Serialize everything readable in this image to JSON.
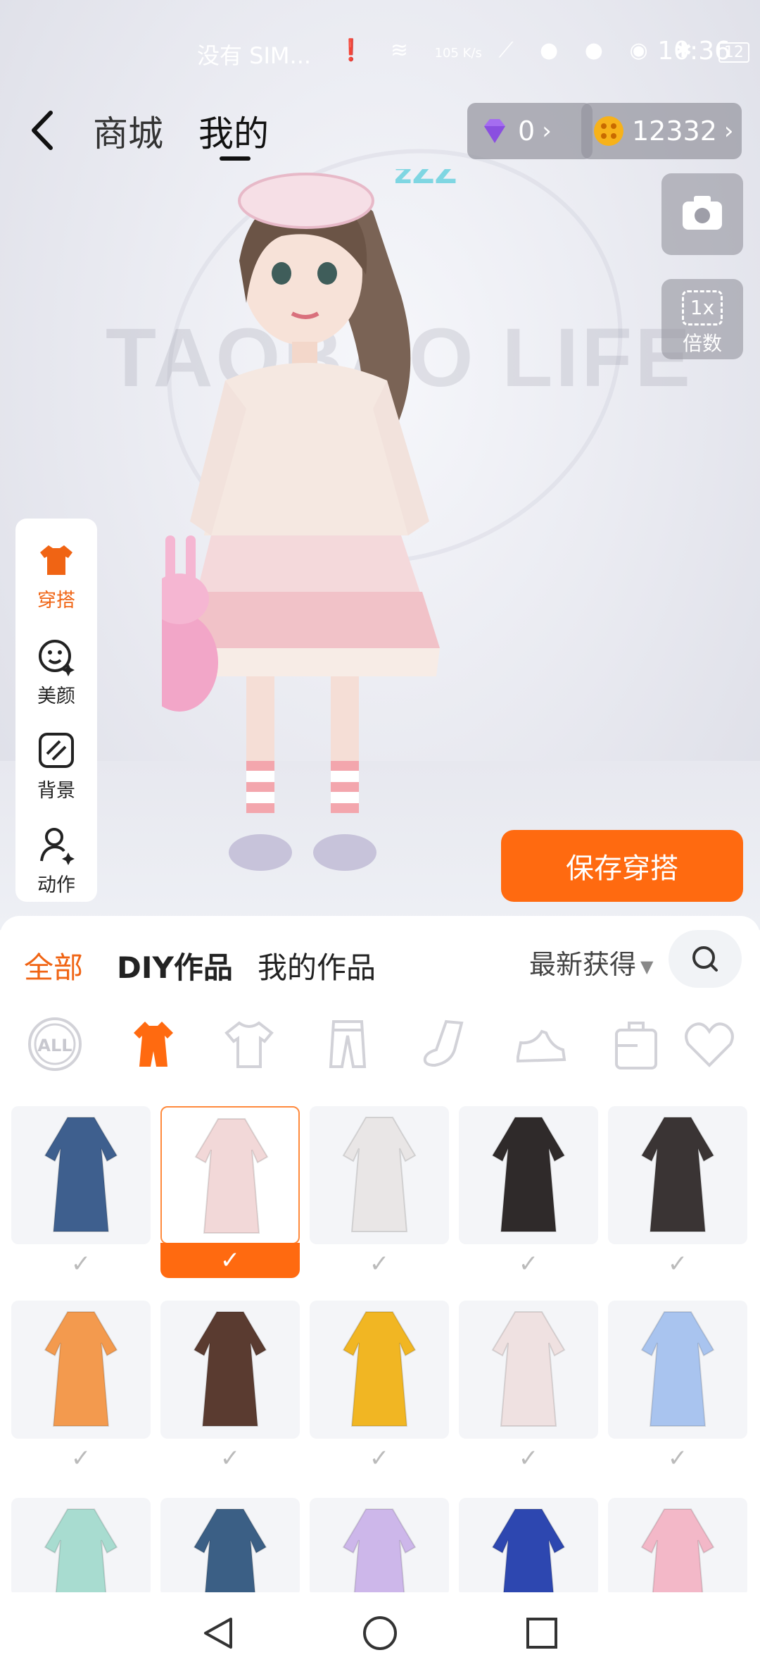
{
  "status_bar": {
    "carrier": "没有 SIM...",
    "net_speed": "105 K/s",
    "battery": "12",
    "time": "10:36"
  },
  "top_nav": {
    "tab_mall": "商城",
    "tab_mine": "我的"
  },
  "currency": {
    "diamonds": "0",
    "coins": "12332"
  },
  "zoom": {
    "value": "1x",
    "label": "倍数"
  },
  "watermark": "TAOBAO LIFE",
  "avatar_decor": "zZZ",
  "left_panel": [
    {
      "label": "穿搭",
      "icon": "outfit-icon",
      "active": true
    },
    {
      "label": "美颜",
      "icon": "face-beauty-icon",
      "active": false
    },
    {
      "label": "背景",
      "icon": "background-icon",
      "active": false
    },
    {
      "label": "动作",
      "icon": "pose-icon",
      "active": false
    }
  ],
  "save_button": "保存穿搭",
  "filter_tabs": {
    "all": "全部",
    "diy": "DIY作品",
    "mine": "我的作品"
  },
  "sort": {
    "label": "最新获得"
  },
  "categories": [
    {
      "icon": "all-icon",
      "label": "ALL",
      "active": false
    },
    {
      "icon": "dress-icon",
      "active": true
    },
    {
      "icon": "tshirt-icon",
      "active": false
    },
    {
      "icon": "pants-icon",
      "active": false
    },
    {
      "icon": "socks-icon",
      "active": false
    },
    {
      "icon": "shoes-icon",
      "active": false
    },
    {
      "icon": "bag-icon",
      "active": false
    },
    {
      "icon": "favorite-icon",
      "active": false
    }
  ],
  "items": [
    {
      "name": "blue-qipao",
      "color": "#3e5f8e",
      "selected": false
    },
    {
      "name": "pink-lolita-dress",
      "color": "#f2d8d8",
      "selected": true
    },
    {
      "name": "floral-slip-dress",
      "color": "#e9e6e6",
      "selected": false
    },
    {
      "name": "black-collar-dress",
      "color": "#2f2a2a",
      "selected": false
    },
    {
      "name": "black-gold-dress",
      "color": "#3a3434",
      "selected": false
    },
    {
      "name": "orange-top-shorts",
      "color": "#f39a4e",
      "selected": false
    },
    {
      "name": "white-blouse-brown-skirt",
      "color": "#5a3b30",
      "selected": false
    },
    {
      "name": "yellow-sweater-pants",
      "color": "#f1b623",
      "selected": false
    },
    {
      "name": "floral-shirt-dress",
      "color": "#efe1e1",
      "selected": false
    },
    {
      "name": "blue-hanfu",
      "color": "#a9c4ef",
      "selected": false
    },
    {
      "name": "mint-hanfu",
      "color": "#a8dcd0",
      "selected": false
    },
    {
      "name": "denim-skirt-outfit",
      "color": "#3b5f85",
      "selected": false
    },
    {
      "name": "lavender-gown",
      "color": "#cdb7ea",
      "selected": false
    },
    {
      "name": "blue-raincoat",
      "color": "#2d47b0",
      "selected": false
    },
    {
      "name": "pink-hanfu",
      "color": "#f3b8c8",
      "selected": false
    }
  ],
  "colors": {
    "accent": "#ff6a10",
    "accent_text": "#f06414"
  }
}
